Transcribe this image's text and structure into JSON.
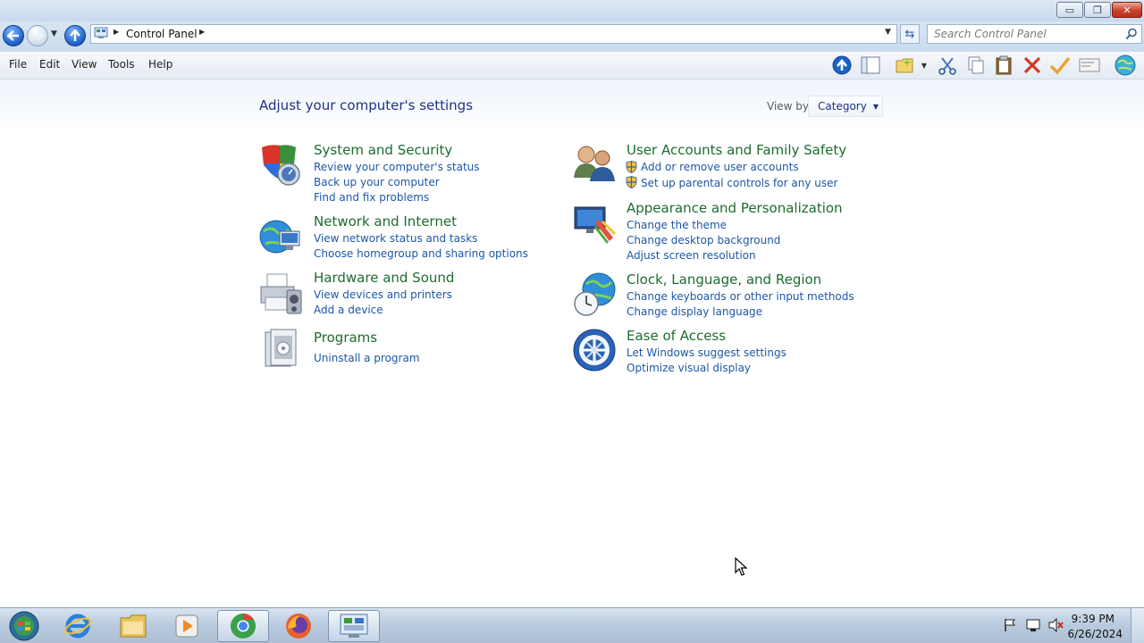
{
  "window": {
    "buttons": {
      "minimize": "▭",
      "maximize": "❐",
      "close": "✕"
    }
  },
  "nav": {
    "breadcrumb": "Control Panel",
    "search_placeholder": "Search Control Panel"
  },
  "menu": {
    "items": [
      "File",
      "Edit",
      "View",
      "Tools",
      "Help"
    ]
  },
  "toolbar": {
    "icons": [
      "up-arrow-icon",
      "layout-pane-icon",
      "new-folder-icon",
      "cut-icon",
      "copy-icon",
      "paste-icon",
      "delete-icon",
      "checkmark-icon",
      "properties-icon",
      "globe-icon"
    ]
  },
  "main": {
    "title": "Adjust your computer's settings",
    "view_by_label": "View by:",
    "view_by_value": "Category",
    "categories": [
      {
        "title": "System and Security",
        "icon": "shield-icon",
        "links": [
          "Review your computer's status",
          "Back up your computer",
          "Find and fix problems"
        ]
      },
      {
        "title": "Network and Internet",
        "icon": "network-globe-icon",
        "links": [
          "View network status and tasks",
          "Choose homegroup and sharing options"
        ]
      },
      {
        "title": "Hardware and Sound",
        "icon": "printer-icon",
        "links": [
          "View devices and printers",
          "Add a device"
        ]
      },
      {
        "title": "Programs",
        "icon": "programs-icon",
        "links": [
          "Uninstall a program"
        ]
      },
      {
        "title": "User Accounts and Family Safety",
        "icon": "users-icon",
        "links": [
          "Add or remove user accounts",
          "Set up parental controls for any user"
        ]
      },
      {
        "title": "Appearance and Personalization",
        "icon": "monitor-paint-icon",
        "links": [
          "Change the theme",
          "Change desktop background",
          "Adjust screen resolution"
        ]
      },
      {
        "title": "Clock, Language, and Region",
        "icon": "clock-globe-icon",
        "links": [
          "Change keyboards or other input methods",
          "Change display language"
        ]
      },
      {
        "title": "Ease of Access",
        "icon": "ease-of-access-icon",
        "links": [
          "Let Windows suggest settings",
          "Optimize visual display"
        ]
      }
    ]
  },
  "taskbar": {
    "apps": [
      "start-orb-icon",
      "internet-explorer-icon",
      "file-explorer-icon",
      "media-player-icon",
      "chrome-icon",
      "firefox-icon",
      "control-panel-icon"
    ],
    "time": "9:39 PM",
    "date": "6/26/2024"
  },
  "colors": {
    "link": "#1d57a8",
    "category_title": "#1e6b2f",
    "heading": "#1e3287"
  }
}
